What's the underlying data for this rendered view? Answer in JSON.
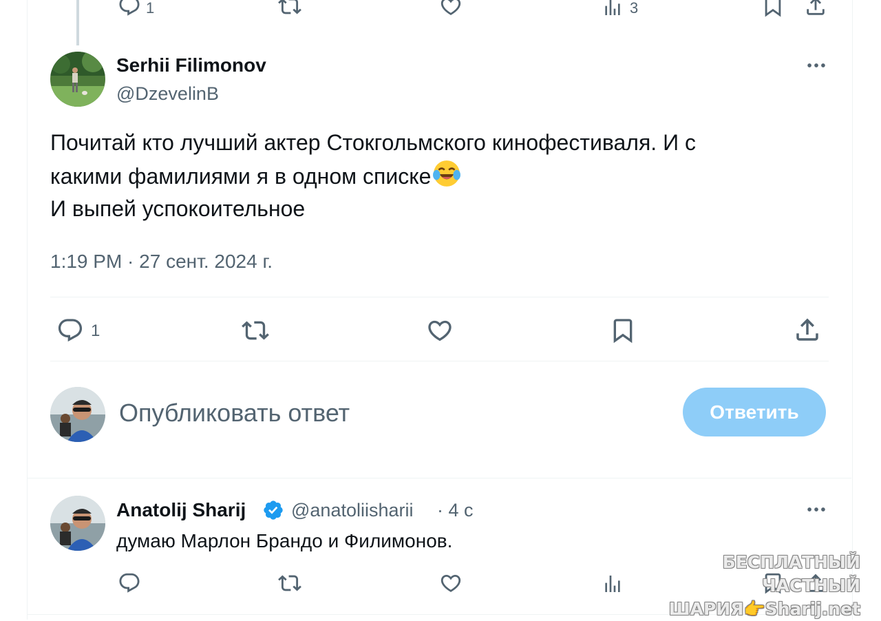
{
  "top_action_bar": {
    "reply_count": "1",
    "views_count": "3"
  },
  "tweet": {
    "author_name": "Serhii Filimonov",
    "author_handle": "@DzevelinB",
    "text_lines": [
      "Почитай кто лучший актер Стокгольмского кинофестиваля. И с",
      "какими фамилиями я в одном списке",
      "И выпей успокоительное"
    ],
    "emoji": "😂",
    "timestamp": "1:19 PM · 27 сент. 2024 г.",
    "reply_count": "1"
  },
  "compose": {
    "placeholder": "Опубликовать ответ",
    "submit_label": "Ответить"
  },
  "reply": {
    "author_name": "Anatolij Sharij",
    "author_handle": "@anatoliisharii",
    "time": "· 4 с",
    "text": "думаю Марлон Брандо и Филимонов."
  },
  "watermark": {
    "line1": "БЕСПЛАТНЫЙ ЧАСТНЫЙ",
    "line2_left": "ШАРИЯ",
    "line2_hand": "👉",
    "line2_right": "Sharij.net"
  },
  "colors": {
    "accent": "#1d9bf0",
    "reply_button_disabled": "#8ecdf8",
    "secondary_text": "#536471",
    "divider": "#eff3f4"
  },
  "icons": {
    "reply": "reply-icon",
    "retweet": "retweet-icon",
    "like": "heart-icon",
    "views": "views-icon",
    "bookmark": "bookmark-icon",
    "share": "share-icon",
    "more": "more-icon",
    "verified": "verified-badge-icon"
  }
}
